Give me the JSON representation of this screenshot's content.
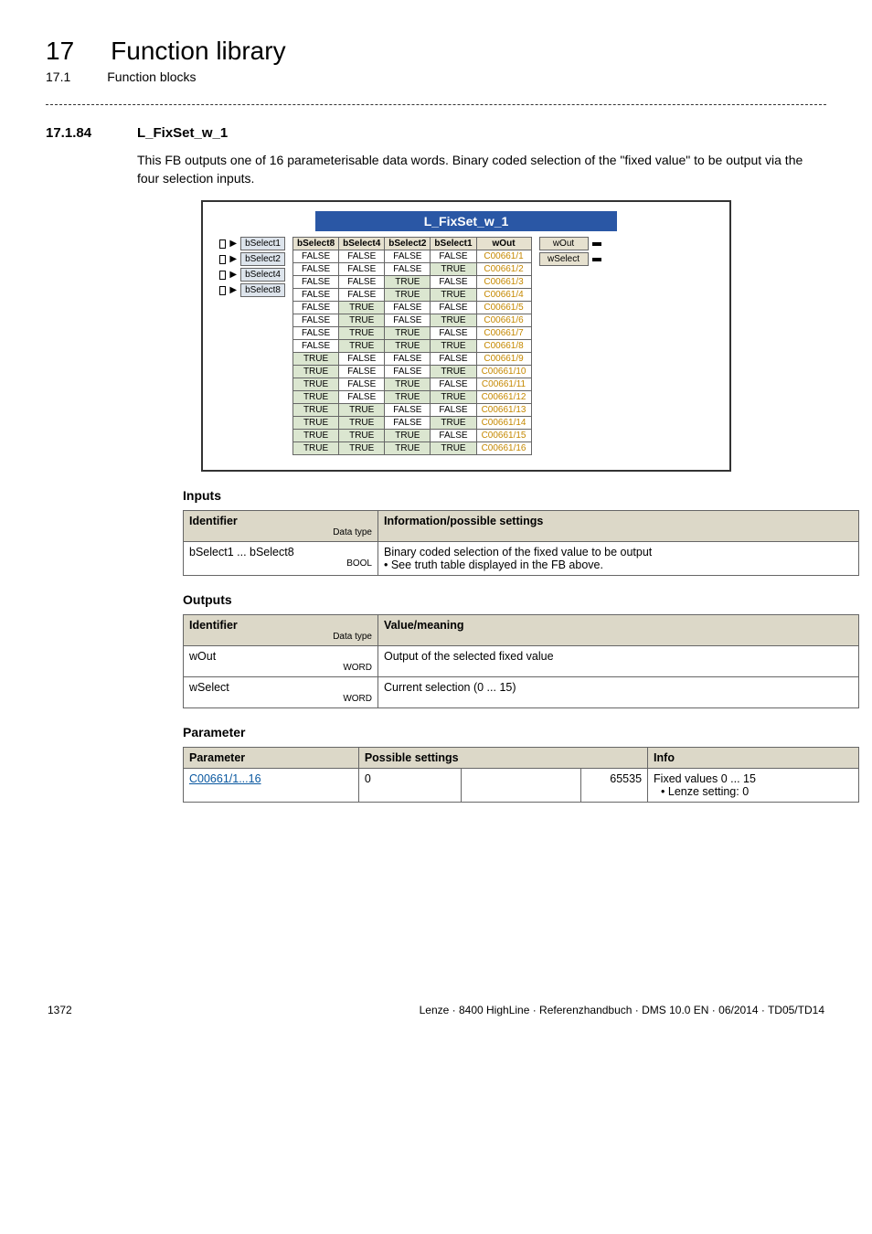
{
  "header": {
    "chapter_num": "17",
    "chapter_title": "Function library",
    "sub_num": "17.1",
    "sub_title": "Function blocks"
  },
  "section": {
    "num": "17.1.84",
    "title": "L_FixSet_w_1",
    "body": "This FB outputs one of 16 parameterisable data words. Binary coded selection of the \"fixed value\" to be output via the four selection inputs."
  },
  "fb": {
    "title": "L_FixSet_w_1",
    "inputs": [
      "bSelect1",
      "bSelect2",
      "bSelect4",
      "bSelect8"
    ],
    "outputs": [
      "wOut",
      "wSelect"
    ],
    "truth_headers": [
      "bSelect8",
      "bSelect4",
      "bSelect2",
      "bSelect1",
      "wOut"
    ],
    "truth_rows": [
      [
        "FALSE",
        "FALSE",
        "FALSE",
        "FALSE",
        "C00661/1"
      ],
      [
        "FALSE",
        "FALSE",
        "FALSE",
        "TRUE",
        "C00661/2"
      ],
      [
        "FALSE",
        "FALSE",
        "TRUE",
        "FALSE",
        "C00661/3"
      ],
      [
        "FALSE",
        "FALSE",
        "TRUE",
        "TRUE",
        "C00661/4"
      ],
      [
        "FALSE",
        "TRUE",
        "FALSE",
        "FALSE",
        "C00661/5"
      ],
      [
        "FALSE",
        "TRUE",
        "FALSE",
        "TRUE",
        "C00661/6"
      ],
      [
        "FALSE",
        "TRUE",
        "TRUE",
        "FALSE",
        "C00661/7"
      ],
      [
        "FALSE",
        "TRUE",
        "TRUE",
        "TRUE",
        "C00661/8"
      ],
      [
        "TRUE",
        "FALSE",
        "FALSE",
        "FALSE",
        "C00661/9"
      ],
      [
        "TRUE",
        "FALSE",
        "FALSE",
        "TRUE",
        "C00661/10"
      ],
      [
        "TRUE",
        "FALSE",
        "TRUE",
        "FALSE",
        "C00661/11"
      ],
      [
        "TRUE",
        "FALSE",
        "TRUE",
        "TRUE",
        "C00661/12"
      ],
      [
        "TRUE",
        "TRUE",
        "FALSE",
        "FALSE",
        "C00661/13"
      ],
      [
        "TRUE",
        "TRUE",
        "FALSE",
        "TRUE",
        "C00661/14"
      ],
      [
        "TRUE",
        "TRUE",
        "TRUE",
        "FALSE",
        "C00661/15"
      ],
      [
        "TRUE",
        "TRUE",
        "TRUE",
        "TRUE",
        "C00661/16"
      ]
    ]
  },
  "inputs_heading": "Inputs",
  "inputs_table": {
    "headers": {
      "id": "Identifier",
      "dtype": "Data type",
      "info": "Information/possible settings"
    },
    "rows": [
      {
        "id": "bSelect1 ... bSelect8",
        "dtype": "BOOL",
        "info_line1": "Binary coded selection of the fixed value to be output",
        "info_line2": "• See truth table displayed in the FB above."
      }
    ]
  },
  "outputs_heading": "Outputs",
  "outputs_table": {
    "headers": {
      "id": "Identifier",
      "dtype": "Data type",
      "info": "Value/meaning"
    },
    "rows": [
      {
        "id": "wOut",
        "dtype": "WORD",
        "info": "Output of the selected fixed value"
      },
      {
        "id": "wSelect",
        "dtype": "WORD",
        "info": "Current selection (0 ... 15)"
      }
    ]
  },
  "param_heading": "Parameter",
  "param_table": {
    "headers": {
      "param": "Parameter",
      "possible": "Possible settings",
      "info": "Info"
    },
    "rows": [
      {
        "param": "C00661/1...16",
        "min": "0",
        "max": "65535",
        "info_line1": "Fixed values 0 ... 15",
        "info_line2": "• Lenze setting: 0"
      }
    ]
  },
  "footer": {
    "page": "1372",
    "right": "Lenze · 8400 HighLine · Referenzhandbuch · DMS 10.0 EN · 06/2014 · TD05/TD14"
  }
}
